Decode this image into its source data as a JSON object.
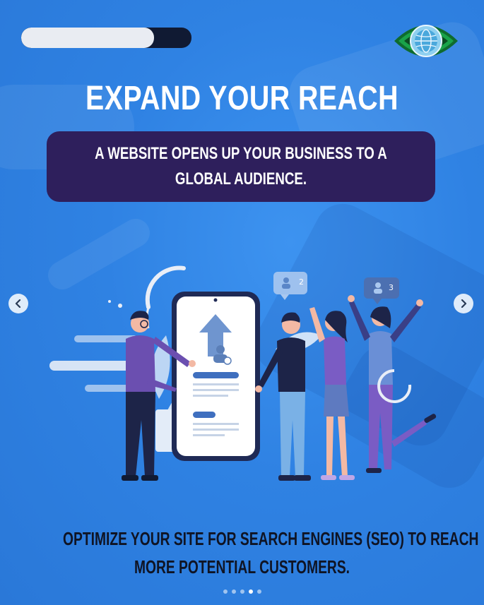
{
  "slide": {
    "progress_fraction": 0.78,
    "title": "EXPAND YOUR REACH",
    "subtitle": "A WEBSITE OPENS UP YOUR BUSINESS TO A GLOBAL AUDIENCE.",
    "footer_line1": "OPTIMIZE YOUR SITE FOR SEARCH ENGINES (SEO) TO REACH",
    "footer_line2": "MORE POTENTIAL CUSTOMERS."
  },
  "navigation": {
    "prev_icon": "chevron-left-icon",
    "next_icon": "chevron-right-icon",
    "dot_count": 5,
    "active_dot_index": 3
  },
  "badges": {
    "left_count": "2",
    "right_count": "3"
  },
  "colors": {
    "background": "#2f86e6",
    "subtitle_box": "#2e1f5c",
    "footer_text": "#0f1424",
    "progress_track": "#101a33",
    "progress_fill": "#e9ecf2",
    "logo_green": "#1aa34a"
  }
}
